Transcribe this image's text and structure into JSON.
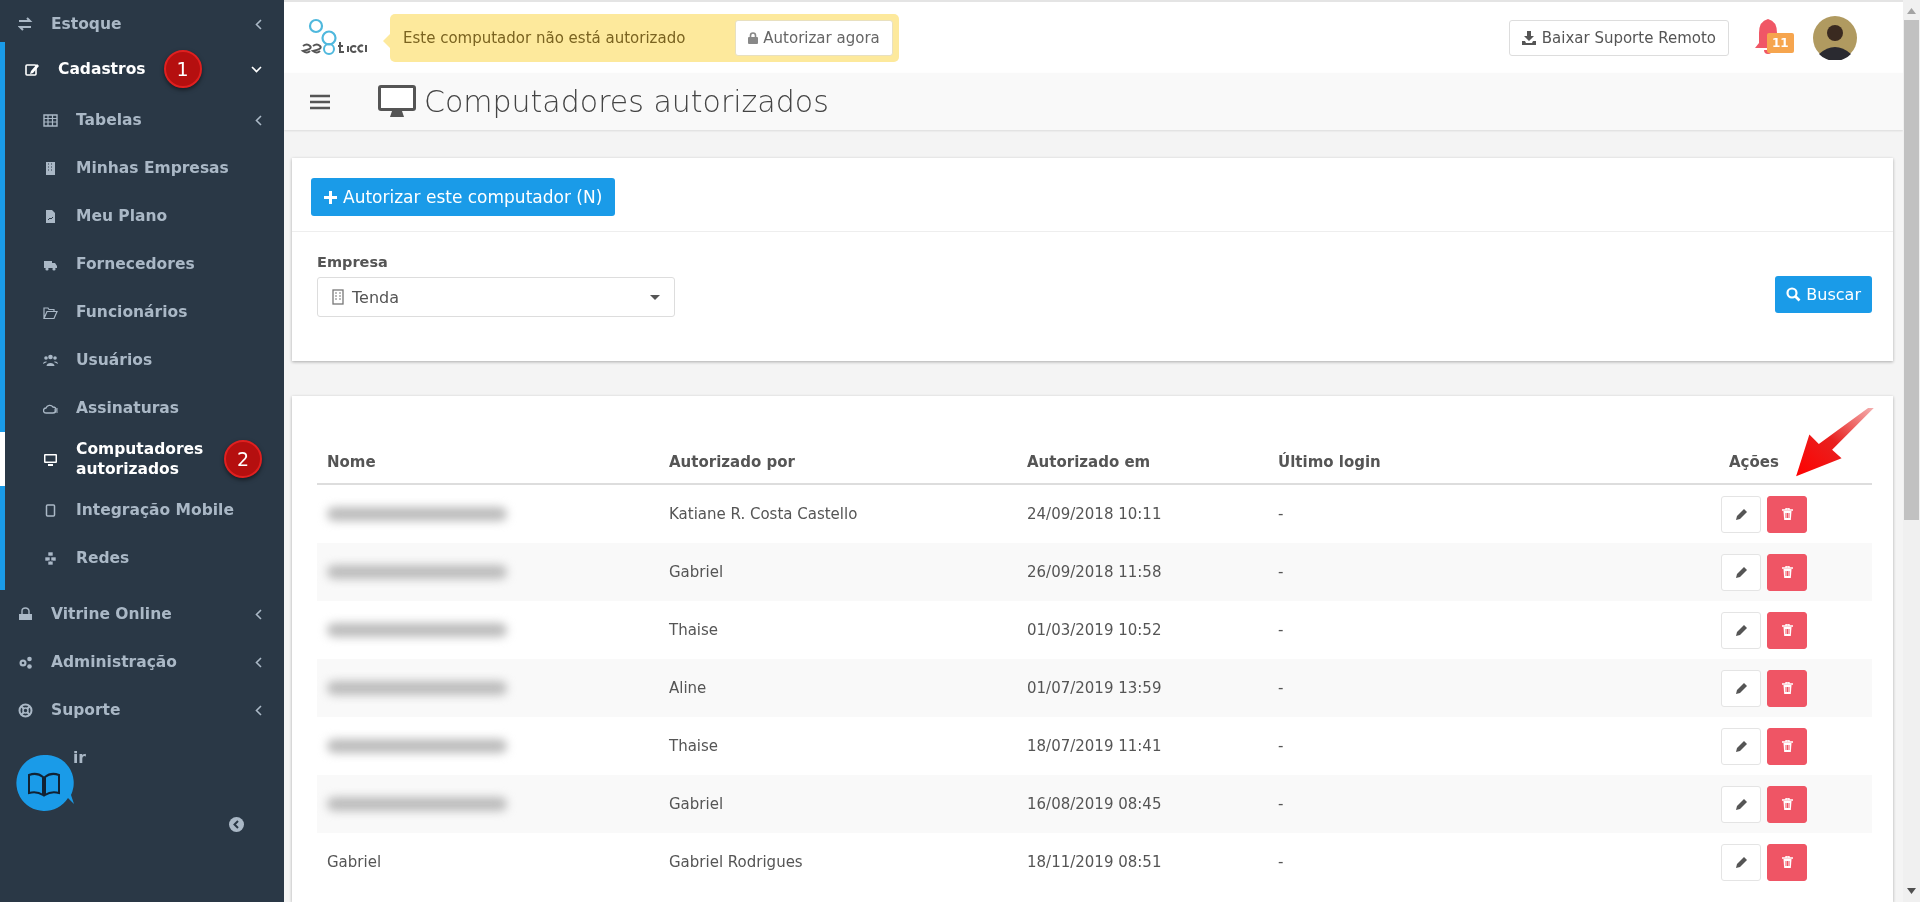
{
  "sidebar": {
    "items": [
      {
        "label": "Estoque",
        "expanded": false
      },
      {
        "label": "Cadastros",
        "expanded": true,
        "badge": "1",
        "children": [
          {
            "label": "Tabelas",
            "expanded": false,
            "selected": false
          },
          {
            "label": "Minhas Empresas",
            "selected": false
          },
          {
            "label": "Meu Plano",
            "selected": false
          },
          {
            "label": "Fornecedores",
            "selected": false
          },
          {
            "label": "Funcionários",
            "selected": false
          },
          {
            "label": "Usuários",
            "selected": false
          },
          {
            "label": "Assinaturas",
            "selected": false
          },
          {
            "label": "Computadores autorizados",
            "selected": true,
            "badge": "2"
          },
          {
            "label": "Integração Mobile",
            "selected": false
          },
          {
            "label": "Redes",
            "selected": false
          }
        ]
      },
      {
        "label": "Vitrine Online",
        "expanded": false
      },
      {
        "label": "Administração",
        "expanded": false
      },
      {
        "label": "Suporte",
        "expanded": false
      },
      {
        "label": "ir"
      }
    ]
  },
  "topbar": {
    "alert": {
      "message": "Este computador não está autorizado",
      "button": "Autorizar agora"
    },
    "support_button": "Baixar Suporte Remoto",
    "notifications": "11"
  },
  "page": {
    "title": "Computadores autorizados"
  },
  "filter": {
    "add_button": "Autorizar este computador (N)",
    "empresa_label": "Empresa",
    "empresa_value": "Tenda",
    "search_button": "Buscar"
  },
  "table": {
    "columns": [
      "Nome",
      "Autorizado por",
      "Autorizado em",
      "Último login",
      "Ações"
    ],
    "rows": [
      {
        "redacted": true,
        "authorized_by": "Katiane R. Costa Castello",
        "authorized_at": "24/09/2018 10:11",
        "last_login": "-"
      },
      {
        "redacted": true,
        "authorized_by": "Gabriel",
        "authorized_at": "26/09/2018 11:58",
        "last_login": "-"
      },
      {
        "redacted": true,
        "authorized_by": "Thaise",
        "authorized_at": "01/03/2019 10:52",
        "last_login": "-"
      },
      {
        "redacted": true,
        "authorized_by": "Aline",
        "authorized_at": "01/07/2019 13:59",
        "last_login": "-"
      },
      {
        "redacted": true,
        "authorized_by": "Thaise",
        "authorized_at": "18/07/2019 11:41",
        "last_login": "-"
      },
      {
        "redacted": true,
        "authorized_by": "Gabriel",
        "authorized_at": "16/08/2019 08:45",
        "last_login": "-"
      },
      {
        "redacted": false,
        "name": "Gabriel",
        "authorized_by": "Gabriel Rodrigues",
        "authorized_at": "18/11/2019 08:51",
        "last_login": "-"
      }
    ]
  }
}
